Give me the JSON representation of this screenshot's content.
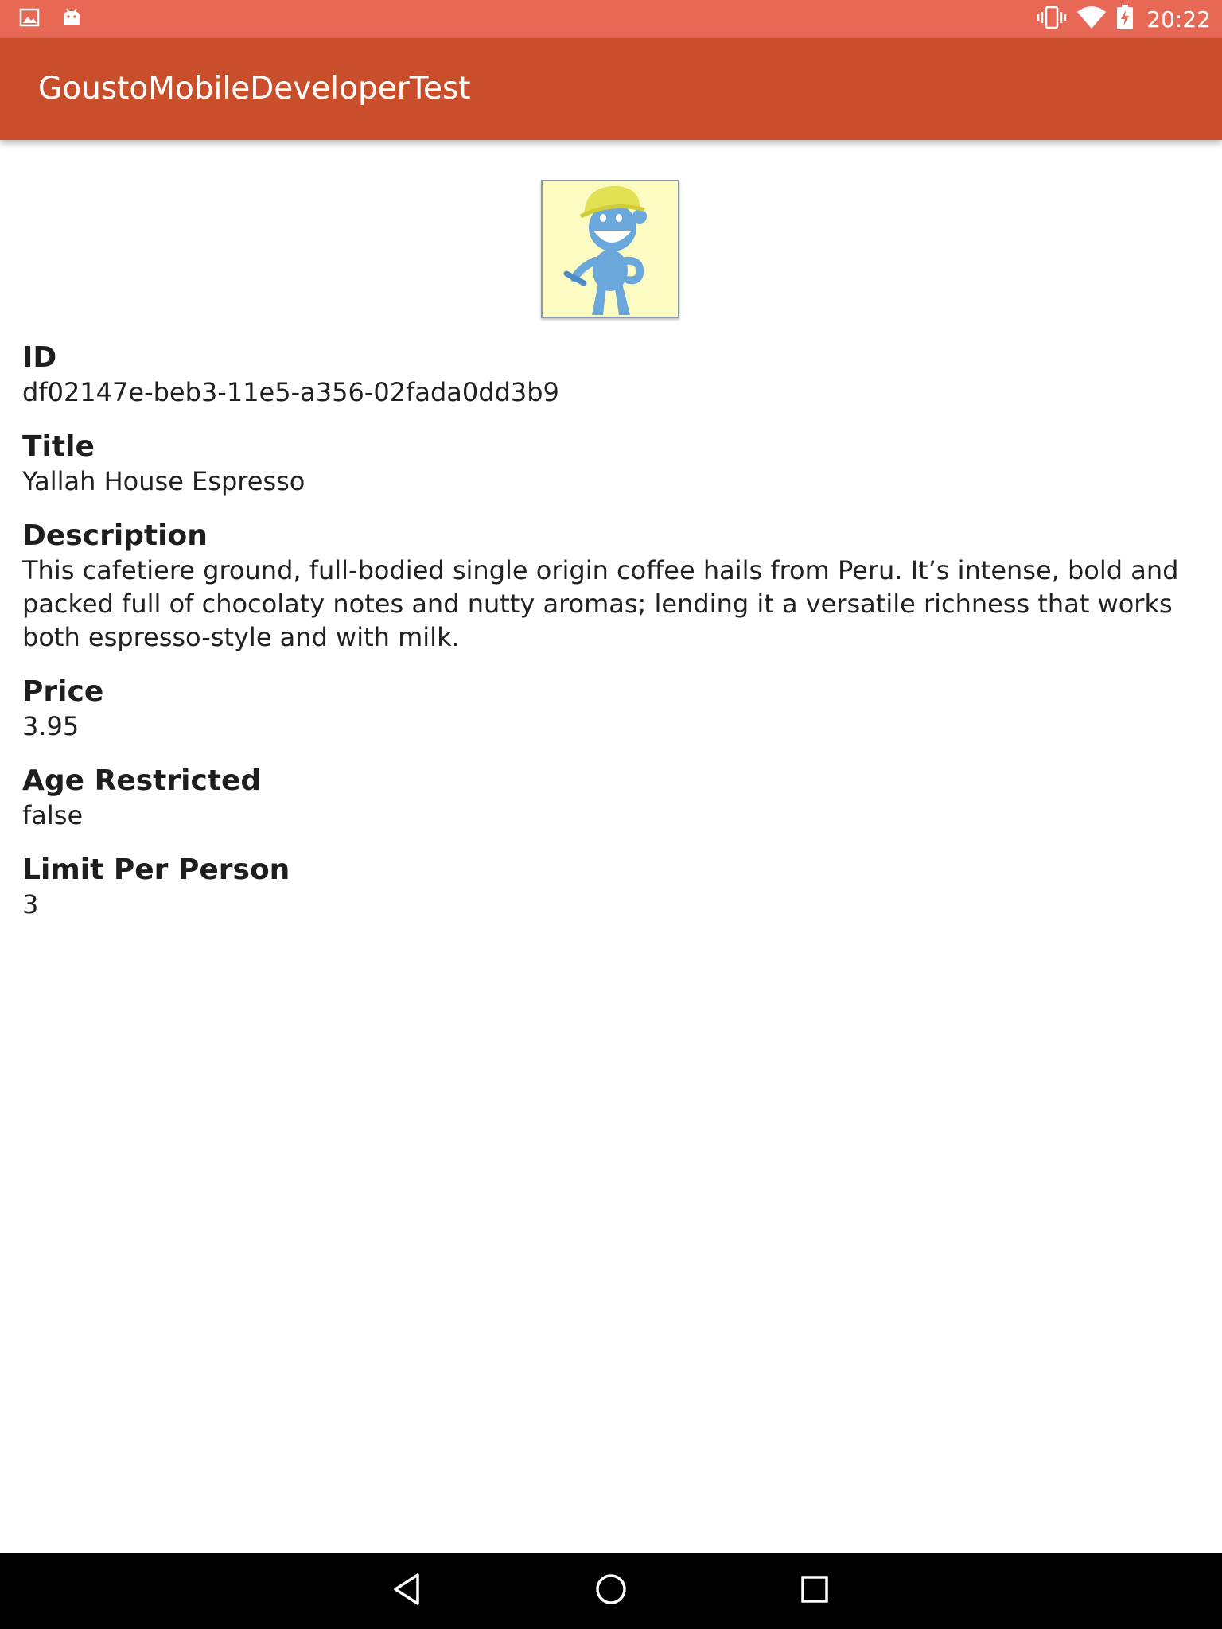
{
  "status_bar": {
    "time": "20:22",
    "icons": [
      "gallery-notification-icon",
      "android-notification-icon",
      "vibrate-icon",
      "wifi-icon",
      "battery-charging-icon"
    ]
  },
  "app_bar": {
    "title": "GoustoMobileDeveloperTest"
  },
  "product": {
    "image_icon": "product-image-cartoon",
    "fields": [
      {
        "label": "ID",
        "value": "df02147e-beb3-11e5-a356-02fada0dd3b9"
      },
      {
        "label": "Title",
        "value": "Yallah House Espresso"
      },
      {
        "label": "Description",
        "value": "This cafetiere ground, full-bodied single origin coffee hails from Peru. It’s intense, bold and packed full of chocolaty notes and nutty aromas; lending it a versatile richness that works both espresso-style and with milk."
      },
      {
        "label": "Price",
        "value": "3.95"
      },
      {
        "label": "Age Restricted",
        "value": "false"
      },
      {
        "label": "Limit Per Person",
        "value": "3"
      }
    ]
  },
  "nav_bar": {
    "buttons": [
      "back-icon",
      "home-icon",
      "recents-icon"
    ]
  },
  "colors": {
    "status_bar": "#e86856",
    "app_bar": "#c94f2c",
    "nav_bar": "#000000",
    "background": "#ffffff"
  }
}
